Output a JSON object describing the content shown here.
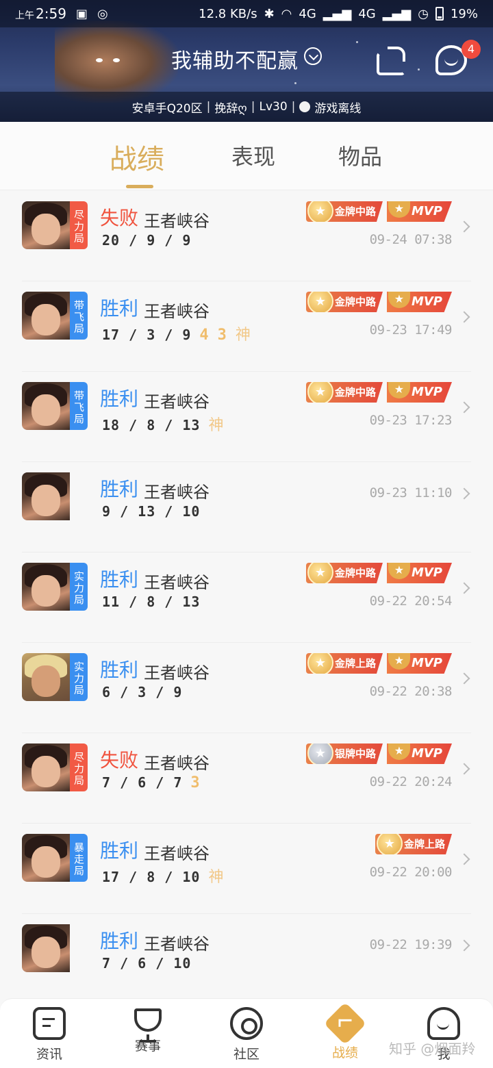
{
  "status_bar": {
    "ampm": "上午",
    "time": "2:59",
    "speed": "12.8 KB/s",
    "net1": "4G",
    "net2": "4G",
    "battery": "19%"
  },
  "header": {
    "title": "我辅助不配赢",
    "notification_count": "4",
    "server": "安卓手Q20区",
    "player": "挽辞ღ",
    "level": "Lv30",
    "status": "游戏离线"
  },
  "tabs": [
    {
      "label": "战绩",
      "active": true
    },
    {
      "label": "表现",
      "active": false
    },
    {
      "label": "物品",
      "active": false
    }
  ],
  "matches": [
    {
      "result": "失败",
      "outcome": "lose",
      "mode": "王者峡谷",
      "kda": "20 / 9 / 9",
      "flair": [],
      "tag": "尽力局",
      "tag_color": "red",
      "hero": "dark",
      "medals": [
        {
          "type": "gold",
          "text": "金牌中路"
        }
      ],
      "mvp": true,
      "date": "09-24 07:38"
    },
    {
      "result": "胜利",
      "outcome": "win",
      "mode": "王者峡谷",
      "kda": "17 / 3 / 9",
      "flair": [
        "4",
        "3",
        "神"
      ],
      "tag": "带飞局",
      "tag_color": "blue",
      "hero": "dark",
      "medals": [
        {
          "type": "gold",
          "text": "金牌中路"
        }
      ],
      "mvp": true,
      "date": "09-23 17:49"
    },
    {
      "result": "胜利",
      "outcome": "win",
      "mode": "王者峡谷",
      "kda": "18 / 8 / 13",
      "flair": [
        "神"
      ],
      "tag": "带飞局",
      "tag_color": "blue",
      "hero": "dark",
      "medals": [
        {
          "type": "gold",
          "text": "金牌中路"
        }
      ],
      "mvp": true,
      "date": "09-23 17:23"
    },
    {
      "result": "胜利",
      "outcome": "win",
      "mode": "王者峡谷",
      "kda": "9 / 13 / 10",
      "flair": [],
      "tag": "",
      "tag_color": "",
      "hero": "dark",
      "medals": [],
      "mvp": false,
      "date": "09-23 11:10"
    },
    {
      "result": "胜利",
      "outcome": "win",
      "mode": "王者峡谷",
      "kda": "11 / 8 / 13",
      "flair": [],
      "tag": "实力局",
      "tag_color": "blue",
      "hero": "dark",
      "medals": [
        {
          "type": "gold",
          "text": "金牌中路"
        }
      ],
      "mvp": true,
      "date": "09-22 20:54"
    },
    {
      "result": "胜利",
      "outcome": "win",
      "mode": "王者峡谷",
      "kda": "6 / 3 / 9",
      "flair": [],
      "tag": "实力局",
      "tag_color": "blue",
      "hero": "blonde",
      "medals": [
        {
          "type": "gold",
          "text": "金牌上路"
        }
      ],
      "mvp": true,
      "date": "09-22 20:38"
    },
    {
      "result": "失败",
      "outcome": "lose",
      "mode": "王者峡谷",
      "kda": "7 / 6 / 7",
      "flair": [
        "3"
      ],
      "tag": "尽力局",
      "tag_color": "red",
      "hero": "dark",
      "medals": [
        {
          "type": "silver",
          "text": "银牌中路"
        }
      ],
      "mvp": true,
      "date": "09-22 20:24"
    },
    {
      "result": "胜利",
      "outcome": "win",
      "mode": "王者峡谷",
      "kda": "17 / 8 / 10",
      "flair": [
        "神"
      ],
      "tag": "暴走局",
      "tag_color": "blue",
      "hero": "dark",
      "medals": [
        {
          "type": "gold",
          "text": "金牌上路"
        }
      ],
      "mvp": false,
      "date": "09-22 20:00"
    },
    {
      "result": "胜利",
      "outcome": "win",
      "mode": "王者峡谷",
      "kda": "7 / 6 / 10",
      "flair": [],
      "tag": "",
      "tag_color": "",
      "hero": "dark",
      "medals": [],
      "mvp": false,
      "date": "09-22 19:39"
    }
  ],
  "mvp_label": "MVP",
  "bottom_nav": [
    {
      "label": "资讯",
      "icon": "news-icon",
      "active": false
    },
    {
      "label": "赛事",
      "icon": "trophy-icon",
      "active": false
    },
    {
      "label": "社区",
      "icon": "community-icon",
      "active": false
    },
    {
      "label": "战绩",
      "icon": "record-icon",
      "active": true
    },
    {
      "label": "我",
      "icon": "me-icon",
      "active": false
    }
  ],
  "watermark": "知乎 @烟面羚",
  "colors": {
    "accent": "#d9ad5c",
    "win": "#3a8ff0",
    "lose": "#f0533e",
    "badge": "#f04b3e"
  }
}
